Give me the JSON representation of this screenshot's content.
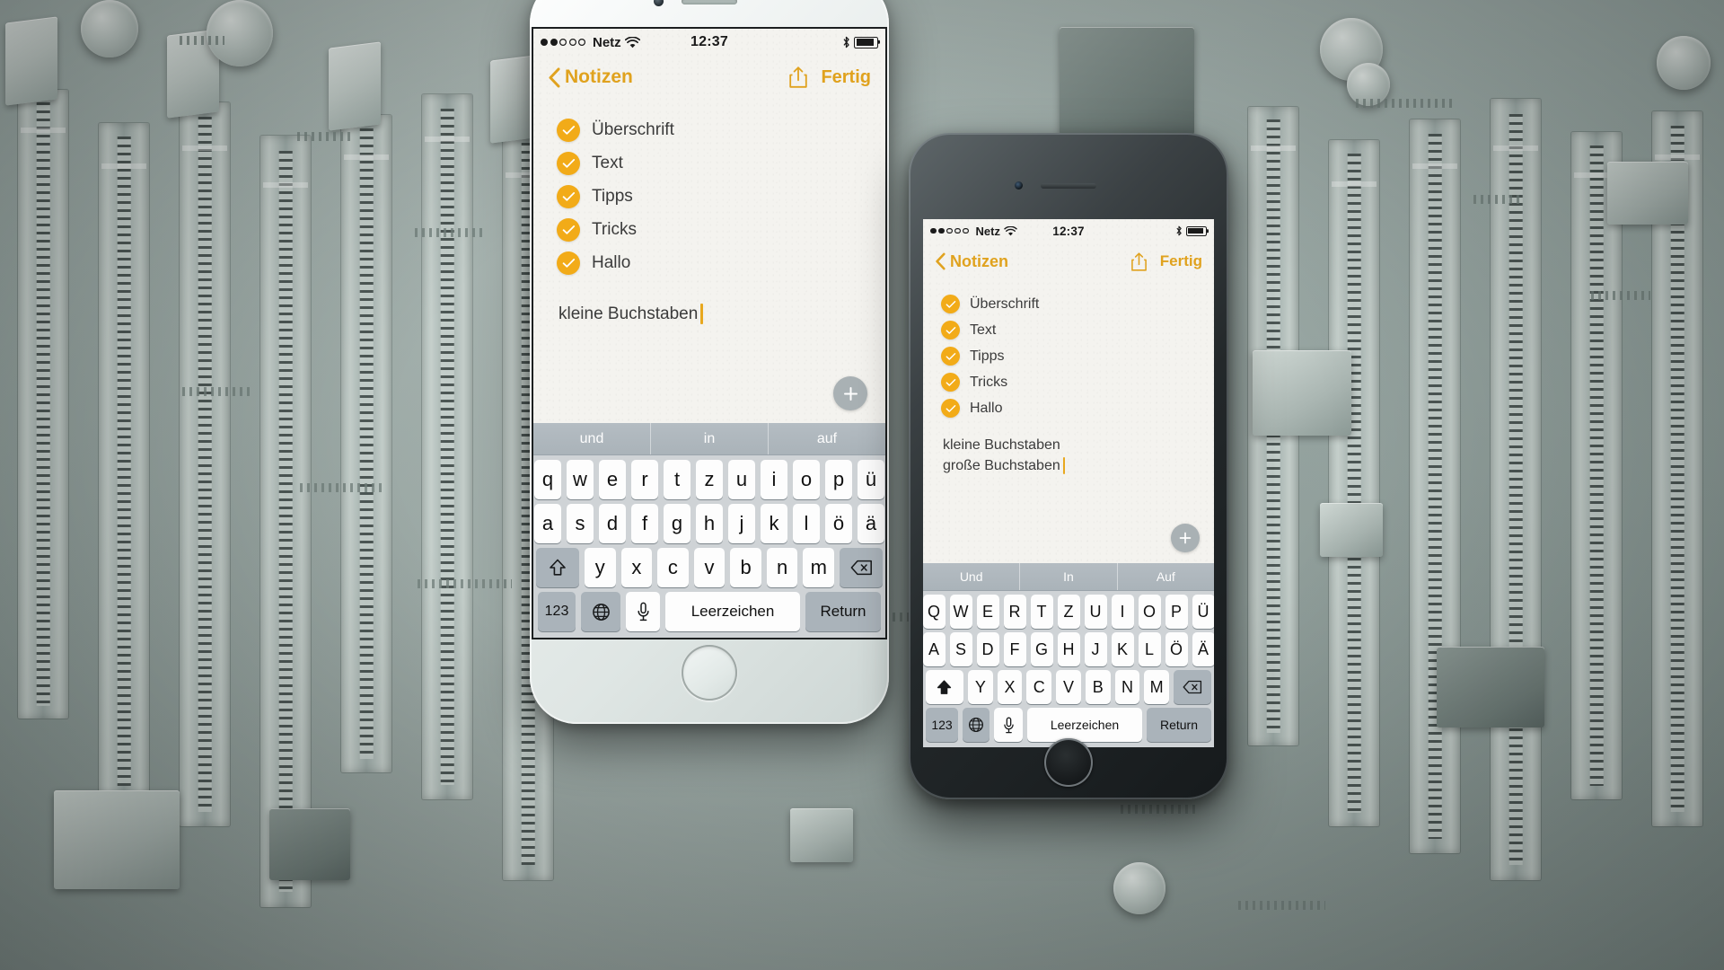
{
  "scene": {
    "background_description": "computer motherboard with memory slots",
    "board_color": "#9aa9a6"
  },
  "theme": {
    "accent": "#e0a21e",
    "check_fill": "#f2ab18",
    "caret": "#e8a81f",
    "paper": "#f3f2ee",
    "keyboard_bg": "#cfd3d6",
    "key_face": "#fdfdfd",
    "key_fn": "#aab3ba",
    "suggestion_bar": "#b0b8be",
    "add_button": "#a9b1b4"
  },
  "phones": [
    {
      "id": "phone-white",
      "device_finish": "silver-white",
      "status_bar": {
        "signal_dots_filled": 2,
        "signal_dots_total": 5,
        "carrier": "Netz",
        "wifi_icon": "wifi-icon",
        "time": "12:37",
        "bluetooth_icon": "bluetooth-icon",
        "battery_icon": "battery-icon",
        "battery_level_percent": 88
      },
      "nav_bar": {
        "back_icon": "chevron-left-icon",
        "back_label": "Notizen",
        "share_icon": "share-icon",
        "done_label": "Fertig"
      },
      "note": {
        "checklist": [
          {
            "label": "Überschrift",
            "checked": true
          },
          {
            "label": "Text",
            "checked": true
          },
          {
            "label": "Tipps",
            "checked": true
          },
          {
            "label": "Tricks",
            "checked": true
          },
          {
            "label": "Hallo",
            "checked": true
          }
        ],
        "text_lines": [
          "kleine Buchstaben"
        ],
        "cursor_after_line_index": 0,
        "add_button_icon": "plus-icon"
      },
      "keyboard": {
        "shift_state": "off",
        "suggestions": [
          "und",
          "in",
          "auf"
        ],
        "rows": [
          [
            "q",
            "w",
            "e",
            "r",
            "t",
            "z",
            "u",
            "i",
            "o",
            "p",
            "ü"
          ],
          [
            "a",
            "s",
            "d",
            "f",
            "g",
            "h",
            "j",
            "k",
            "l",
            "ö",
            "ä"
          ],
          [
            "y",
            "x",
            "c",
            "v",
            "b",
            "n",
            "m"
          ]
        ],
        "shift_icon": "shift-icon",
        "backspace_icon": "backspace-icon",
        "numbers_label": "123",
        "globe_icon": "globe-icon",
        "mic_icon": "microphone-icon",
        "space_label": "Leerzeichen",
        "return_label": "Return"
      }
    },
    {
      "id": "phone-dark",
      "device_finish": "space-gray",
      "status_bar": {
        "signal_dots_filled": 2,
        "signal_dots_total": 5,
        "carrier": "Netz",
        "wifi_icon": "wifi-icon",
        "time": "12:37",
        "bluetooth_icon": "bluetooth-icon",
        "battery_icon": "battery-icon",
        "battery_level_percent": 88
      },
      "nav_bar": {
        "back_icon": "chevron-left-icon",
        "back_label": "Notizen",
        "share_icon": "share-icon",
        "done_label": "Fertig"
      },
      "note": {
        "checklist": [
          {
            "label": "Überschrift",
            "checked": true
          },
          {
            "label": "Text",
            "checked": true
          },
          {
            "label": "Tipps",
            "checked": true
          },
          {
            "label": "Tricks",
            "checked": true
          },
          {
            "label": "Hallo",
            "checked": true
          }
        ],
        "text_lines": [
          "kleine Buchstaben",
          "große Buchstaben"
        ],
        "cursor_after_line_index": 1,
        "add_button_icon": "plus-icon"
      },
      "keyboard": {
        "shift_state": "on",
        "suggestions": [
          "Und",
          "In",
          "Auf"
        ],
        "rows": [
          [
            "Q",
            "W",
            "E",
            "R",
            "T",
            "Z",
            "U",
            "I",
            "O",
            "P",
            "Ü"
          ],
          [
            "A",
            "S",
            "D",
            "F",
            "G",
            "H",
            "J",
            "K",
            "L",
            "Ö",
            "Ä"
          ],
          [
            "Y",
            "X",
            "C",
            "V",
            "B",
            "N",
            "M"
          ]
        ],
        "shift_icon": "shift-icon",
        "backspace_icon": "backspace-icon",
        "numbers_label": "123",
        "globe_icon": "globe-icon",
        "mic_icon": "microphone-icon",
        "space_label": "Leerzeichen",
        "return_label": "Return"
      }
    }
  ]
}
